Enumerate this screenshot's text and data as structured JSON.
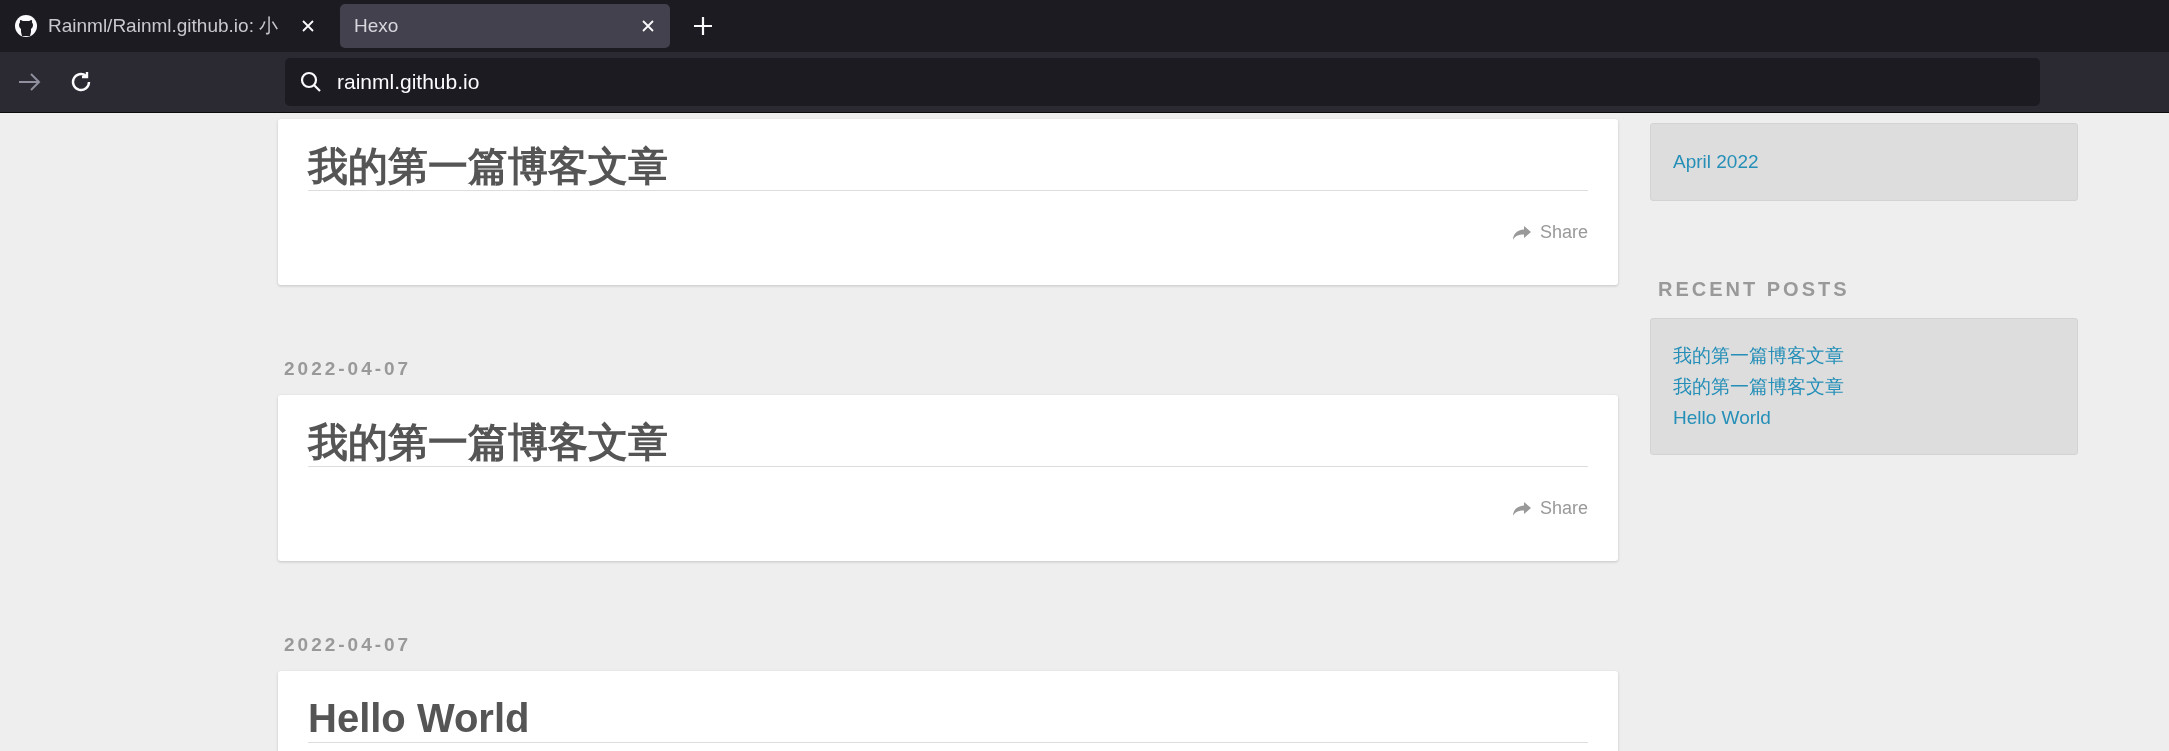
{
  "tabs": [
    {
      "kind": "favicon",
      "title": "Rainml/Rainml.github.io: 小",
      "selected": false
    },
    {
      "kind": "plain",
      "title": "Hexo",
      "selected": true
    }
  ],
  "toolbar": {
    "buttons": [
      {
        "kind": "forward",
        "disabled": true
      },
      {
        "kind": "reload",
        "disabled": false
      }
    ],
    "address": "rainml.github.io"
  },
  "posts": [
    {
      "title": "我的第一篇博客文章",
      "share": "Share"
    },
    {
      "date": "2022-04-07",
      "title": "我的第一篇博客文章",
      "share": "Share"
    },
    {
      "date": "2022-04-07",
      "title": "Hello World"
    }
  ],
  "sidebar": {
    "archives": [
      "April 2022"
    ],
    "recent_posts": {
      "heading": "RECENT POSTS",
      "items": [
        "我的第一篇博客文章",
        "我的第一篇博客文章",
        "Hello World"
      ]
    }
  }
}
